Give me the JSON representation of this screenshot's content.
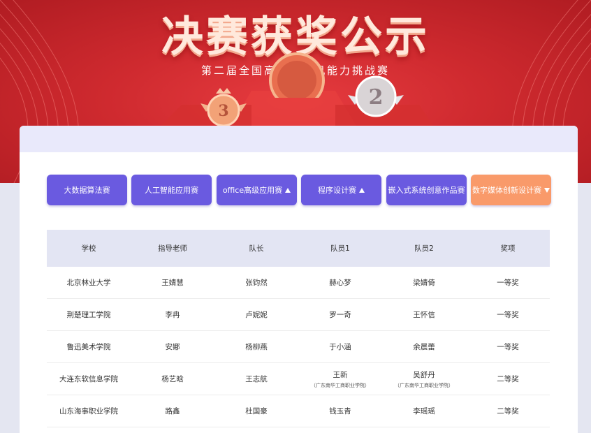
{
  "banner": {
    "title": "决赛获奖公示",
    "subtitle": "第二届全国高校计算机能力挑战赛",
    "medal_left": "3",
    "medal_right": "2"
  },
  "colors": {
    "banner_red": "#cf2a2f",
    "tab_purple": "#6a5ae0",
    "tab_active": "#f99a6a",
    "header_bg": "#e3e5f3"
  },
  "tabs": [
    {
      "label": "大数据算法赛",
      "caret": ""
    },
    {
      "label": "人工智能应用赛",
      "caret": ""
    },
    {
      "label": "office高级应用赛",
      "caret": "up"
    },
    {
      "label": "程序设计赛",
      "caret": "up"
    },
    {
      "label": "嵌入式系统创意作品赛",
      "caret": ""
    },
    {
      "label": "数字媒体创新设计赛",
      "caret": "down",
      "active": true
    }
  ],
  "table": {
    "headers": [
      "学校",
      "指导老师",
      "队长",
      "队员1",
      "队员2",
      "奖项"
    ],
    "rows": [
      {
        "school": "北京林业大学",
        "teacher": "王婧慧",
        "captain": "张钧然",
        "member1": "赫心梦",
        "member1_note": "",
        "member2": "梁婧倚",
        "member2_note": "",
        "award": "一等奖"
      },
      {
        "school": "荆楚理工学院",
        "teacher": "李冉",
        "captain": "卢妮妮",
        "member1": "罗一奇",
        "member1_note": "",
        "member2": "王怀信",
        "member2_note": "",
        "award": "一等奖"
      },
      {
        "school": "鲁迅美术学院",
        "teacher": "安娜",
        "captain": "杨柳燕",
        "member1": "于小涵",
        "member1_note": "",
        "member2": "余晨蕾",
        "member2_note": "",
        "award": "一等奖"
      },
      {
        "school": "大连东软信息学院",
        "teacher": "杨艺晗",
        "captain": "王志航",
        "member1": "王新",
        "member1_note": "（广东南华工商职业学院）",
        "member2": "吴舒丹",
        "member2_note": "（广东南华工商职业学院）",
        "award": "二等奖"
      },
      {
        "school": "山东海事职业学院",
        "teacher": "路鑫",
        "captain": "杜国豪",
        "member1": "钱玉青",
        "member1_note": "",
        "member2": "李瑶瑶",
        "member2_note": "",
        "award": "二等奖"
      }
    ]
  }
}
